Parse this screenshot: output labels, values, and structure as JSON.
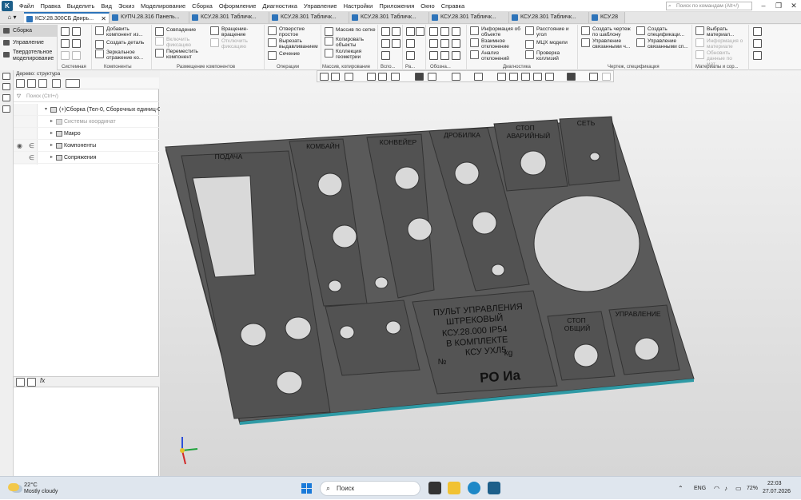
{
  "menubar": {
    "items": [
      "Файл",
      "Правка",
      "Выделить",
      "Вид",
      "Эскиз",
      "Моделирование",
      "Сборка",
      "Оформление",
      "Диагностика",
      "Управление",
      "Настройки",
      "Приложения",
      "Окно",
      "Справка"
    ],
    "search_placeholder": "Поиск по командам (Alt+/)"
  },
  "tabs": [
    {
      "label": "КСУ.28.300СБ Двирь...",
      "active": true
    },
    {
      "label": "КУПЧ.28.316 Панель...",
      "active": false
    },
    {
      "label": "КСУ.28.301 Табличк...",
      "active": false
    },
    {
      "label": "КСУ.28.301 Табличк...",
      "active": false
    },
    {
      "label": "КСУ.28.301 Табличк...",
      "active": false
    },
    {
      "label": "КСУ.28.301 Табличк...",
      "active": false
    },
    {
      "label": "КСУ.28.301 Табличк...",
      "active": false
    },
    {
      "label": "КСУ.28",
      "active": false
    }
  ],
  "modes": [
    "Сборка",
    "Управление",
    "Твердотельное моделирование"
  ],
  "ribbon": {
    "system_label": "Системная",
    "components_label": "Компоненты",
    "placement_label": "Размещение компонентов",
    "operations_label": "Операции",
    "array_label": "Массив, копирование",
    "aux_label": "Вспо...",
    "ra_label": "Ра...",
    "oboz_label": "Обозна...",
    "diag_label": "Диагностика",
    "drawing_label": "Чертеж, спецификация",
    "materials_label": "Материалы и сор...",
    "btn_add_component": "Добавить компонент из...",
    "btn_create_part": "Создать деталь",
    "btn_mirror": "Зеркальное отражение ко...",
    "btn_coincide": "Совпадение",
    "btn_enable_fix": "Включить фиксацию",
    "btn_rotate": "Вращение-вращение",
    "btn_disable_fix": "Отключить фиксацию",
    "btn_move": "Переместить компонент",
    "btn_hole": "Отверстие простое",
    "btn_cut": "Вырезать выдавливанием",
    "btn_section": "Сечение",
    "btn_array_grid": "Массив по сетке",
    "btn_copy": "Копировать объекты",
    "btn_collect": "Коллекция геометрии",
    "btn_info": "Информация об объекте",
    "btn_deviation": "Взаимное отклонение",
    "btn_analysis": "Анализ отклонений",
    "btn_distance": "Расстояние и угол",
    "btn_mcx": "МЦХ модели",
    "btn_collisions": "Проверка коллизий",
    "btn_create_drawing": "Создать чертеж по шаблону",
    "btn_control_links": "Управление связанными ч...",
    "btn_create_spec": "Создать спецификаци...",
    "btn_control_spec": "Управление связанными сп...",
    "btn_choose_material": "Выбрать материал...",
    "btn_material_info": "Информация о материале",
    "btn_update_data": "Обновить данные по мат..."
  },
  "tree": {
    "title": "Дерево: структура",
    "filter_placeholder": "Поиск (Ctrl+/)",
    "root": "(+)Сборка (Тел-0, Сборочных единиц-0",
    "items": [
      "Системы координат",
      "Макро",
      "Компоненты",
      "Сопряжения"
    ]
  },
  "model": {
    "podacha": "ПОДАЧА",
    "combine": "КОМБАЙН",
    "conveyor": "КОНВЕЙЕР",
    "crusher": "ДРОБИЛКА",
    "stop_emergency_1": "СТОП",
    "stop_emergency_2": "АВАРИЙНЫЙ",
    "set": "СЕТЬ",
    "title_1": "ПУЛЬТ УПРАВЛЕНИЯ",
    "title_2": "ШТРЕКОВЫЙ",
    "title_3": "КСУ.28.000   IP54",
    "title_4": "В КОМПЛЕКТЕ",
    "title_5": "КСУ УХЛ5",
    "kg": "kg",
    "number": "№",
    "marking": "РО  Иа",
    "stop_general_1": "СТОП",
    "stop_general_2": "ОБЩИЙ",
    "control": "УПРАВЛЕНИЕ"
  },
  "taskbar": {
    "temperature": "22°C",
    "weather": "Mostly cloudy",
    "search": "Поиск",
    "lang": "ENG",
    "battery": "72%",
    "time": "22:03",
    "date": "27.07.2026"
  },
  "colors": {
    "accent": "#2d73b9",
    "panel": "#5b5b5b",
    "panel_edge": "#3d3d3d"
  }
}
